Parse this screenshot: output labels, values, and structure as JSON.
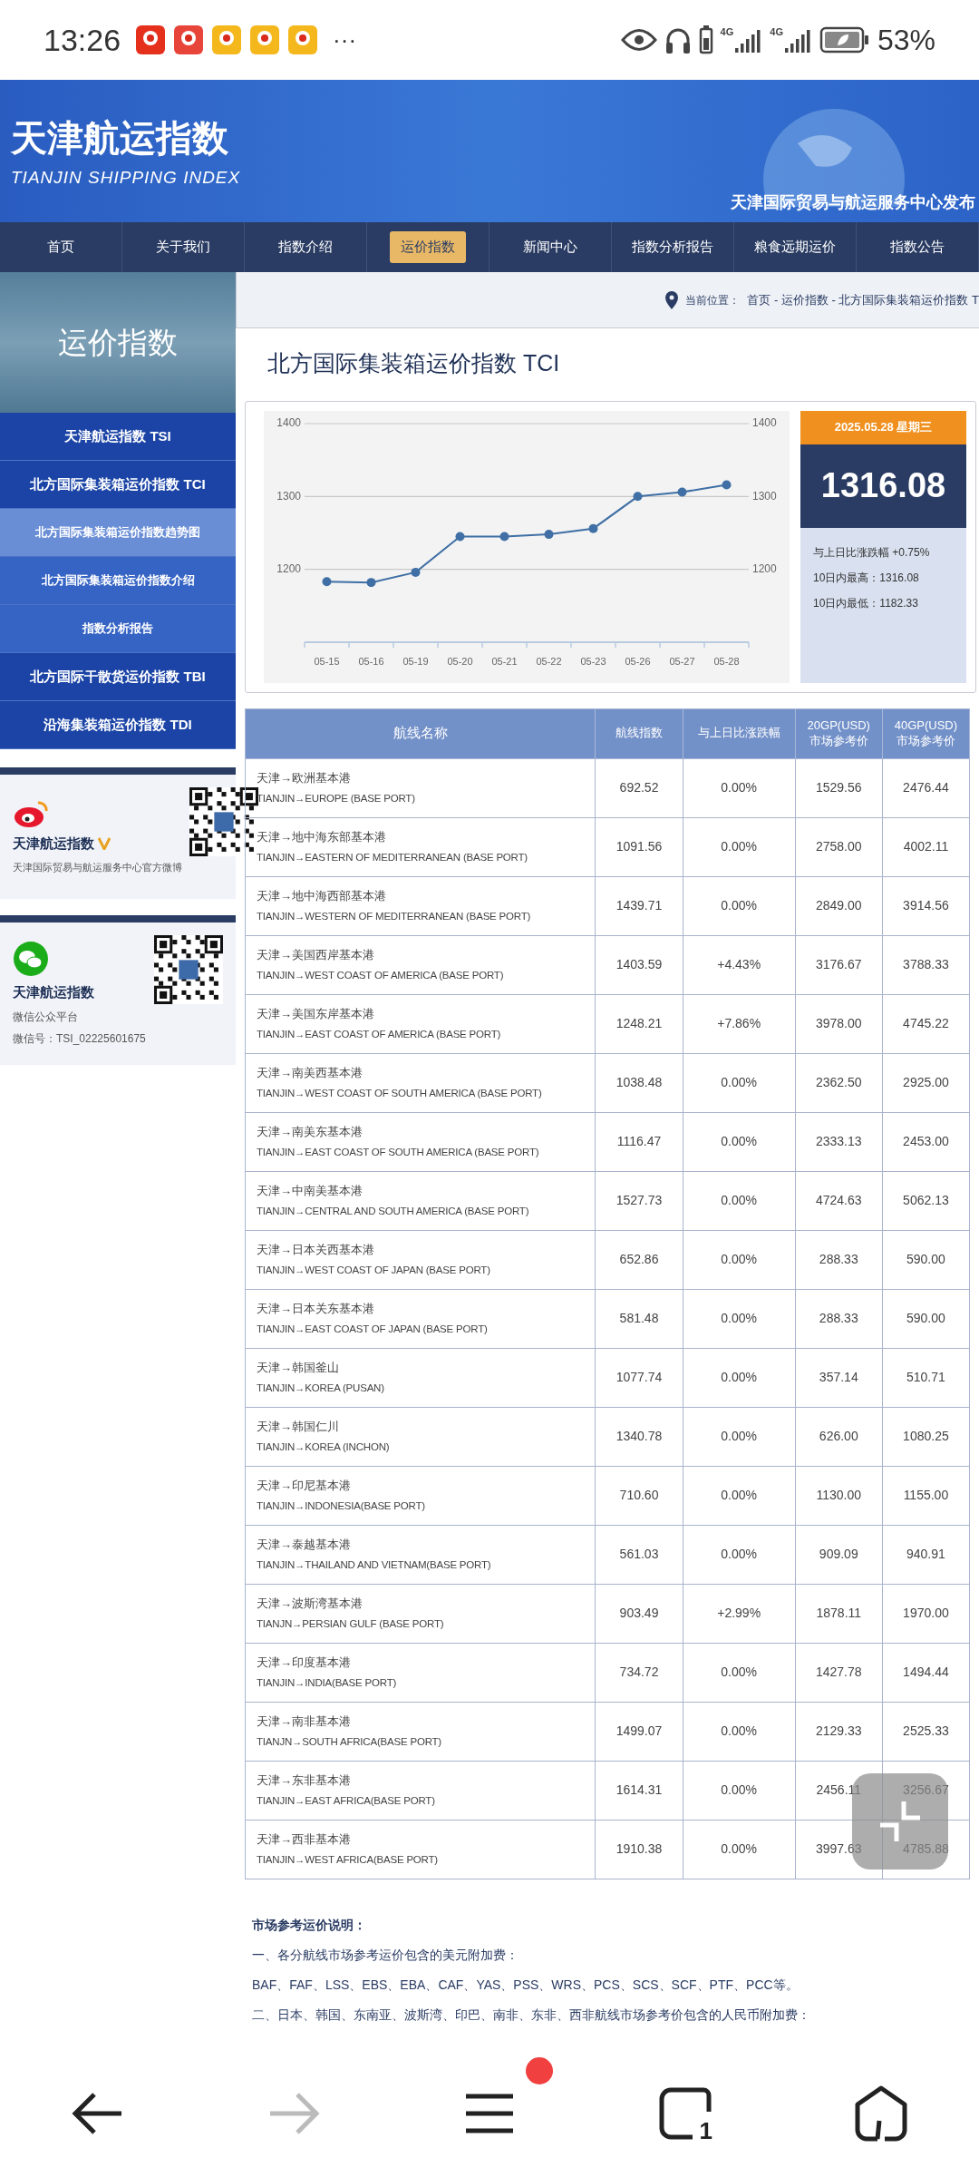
{
  "status_bar": {
    "time": "13:26",
    "more": "···",
    "network": [
      "4G",
      "4G"
    ],
    "battery": "53%"
  },
  "header": {
    "title_cn": "天津航运指数",
    "title_en": "TIANJIN SHIPPING INDEX",
    "slogan": "天津国际贸易与航运服务中心发布"
  },
  "nav": [
    {
      "label": "首页",
      "selected": false
    },
    {
      "label": "关于我们",
      "selected": false
    },
    {
      "label": "指数介绍",
      "selected": false
    },
    {
      "label": "运价指数",
      "selected": true
    },
    {
      "label": "新闻中心",
      "selected": false
    },
    {
      "label": "指数分析报告",
      "selected": false
    },
    {
      "label": "粮食远期运价",
      "selected": false
    },
    {
      "label": "指数公告",
      "selected": false
    }
  ],
  "sidebar": {
    "title": "运价指数",
    "items": [
      {
        "label": "天津航运指数 TSI",
        "kind": "main",
        "selected": false
      },
      {
        "label": "北方国际集装箱运价指数 TCI",
        "kind": "main",
        "selected": false
      },
      {
        "label": "北方国际集装箱运价指数趋势图",
        "kind": "sub",
        "selected": true
      },
      {
        "label": "北方国际集装箱运价指数介绍",
        "kind": "sub",
        "selected": false
      },
      {
        "label": "指数分析报告",
        "kind": "sub",
        "selected": false
      },
      {
        "label": "北方国际干散货运价指数 TBI",
        "kind": "main",
        "selected": false
      },
      {
        "label": "沿海集装箱运价指数 TDI",
        "kind": "main",
        "selected": false
      }
    ],
    "weibo": {
      "name": "天津航运指数",
      "verified": true,
      "desc": "天津国际贸易与航运服务中心官方微博"
    },
    "wechat": {
      "name": "天津航运指数",
      "line1": "微信公众平台",
      "line2": "微信号：TSI_02225601675"
    }
  },
  "breadcrumb": {
    "label": "当前位置：",
    "path": "首页 - 运价指数 - 北方国际集装箱运价指数 T"
  },
  "page_title": "北方国际集装箱运价指数 TCI",
  "chart_data": {
    "type": "line",
    "categories": [
      "05-15",
      "05-16",
      "05-19",
      "05-20",
      "05-21",
      "05-22",
      "05-23",
      "05-26",
      "05-27",
      "05-28"
    ],
    "series": [
      {
        "color": "#3f6fa5",
        "marker": "circle",
        "values": [
          1183,
          1182,
          1196,
          1245,
          1245,
          1248,
          1256,
          1300,
          1306,
          1316
        ]
      }
    ],
    "ylim": [
      1100,
      1400
    ],
    "yticks": [
      1200,
      1300,
      1400
    ],
    "annotations": [
      "1200",
      "1300",
      "1400"
    ]
  },
  "summary": {
    "date": "2025.05.28 星期三",
    "value": "1316.08",
    "change": "与上日比涨跌幅 +0.75%",
    "high": "10日内最高：1316.08",
    "low": "10日内最低：1182.33"
  },
  "table": {
    "columns": [
      {
        "label": "航线名称"
      },
      {
        "label": "航线指数"
      },
      {
        "label": "与上日比涨跌幅"
      },
      {
        "label": "20GP(USD)",
        "sublabel": "市场参考价"
      },
      {
        "label": "40GP(USD)",
        "sublabel": "市场参考价"
      }
    ],
    "rows": [
      {
        "route_cn": "天津→欧洲基本港",
        "route_en": "TIANJIN→EUROPE (BASE PORT)",
        "index": "692.52",
        "change": "0.00%",
        "gp20": "1529.56",
        "gp40": "2476.44"
      },
      {
        "route_cn": "天津→地中海东部基本港",
        "route_en": "TIANJIN→EASTERN OF MEDITERRANEAN (BASE PORT)",
        "index": "1091.56",
        "change": "0.00%",
        "gp20": "2758.00",
        "gp40": "4002.11"
      },
      {
        "route_cn": "天津→地中海西部基本港",
        "route_en": "TIANJIN→WESTERN OF MEDITERRANEAN (BASE PORT)",
        "index": "1439.71",
        "change": "0.00%",
        "gp20": "2849.00",
        "gp40": "3914.56"
      },
      {
        "route_cn": "天津→美国西岸基本港",
        "route_en": "TIANJIN→WEST COAST OF AMERICA (BASE PORT)",
        "index": "1403.59",
        "change": "+4.43%",
        "gp20": "3176.67",
        "gp40": "3788.33"
      },
      {
        "route_cn": "天津→美国东岸基本港",
        "route_en": "TIANJIN→EAST COAST OF AMERICA (BASE PORT)",
        "index": "1248.21",
        "change": "+7.86%",
        "gp20": "3978.00",
        "gp40": "4745.22"
      },
      {
        "route_cn": "天津→南美西基本港",
        "route_en": "TIANJIN→WEST COAST OF SOUTH AMERICA (BASE PORT)",
        "index": "1038.48",
        "change": "0.00%",
        "gp20": "2362.50",
        "gp40": "2925.00"
      },
      {
        "route_cn": "天津→南美东基本港",
        "route_en": "TIANJIN→EAST COAST OF SOUTH AMERICA (BASE PORT)",
        "index": "1116.47",
        "change": "0.00%",
        "gp20": "2333.13",
        "gp40": "2453.00"
      },
      {
        "route_cn": "天津→中南美基本港",
        "route_en": "TIANJIN→CENTRAL AND SOUTH AMERICA (BASE PORT)",
        "index": "1527.73",
        "change": "0.00%",
        "gp20": "4724.63",
        "gp40": "5062.13"
      },
      {
        "route_cn": "天津→日本关西基本港",
        "route_en": "TIANJIN→WEST COAST OF JAPAN (BASE PORT)",
        "index": "652.86",
        "change": "0.00%",
        "gp20": "288.33",
        "gp40": "590.00"
      },
      {
        "route_cn": "天津→日本关东基本港",
        "route_en": "TIANJIN→EAST COAST OF JAPAN (BASE PORT)",
        "index": "581.48",
        "change": "0.00%",
        "gp20": "288.33",
        "gp40": "590.00"
      },
      {
        "route_cn": "天津→韩国釜山",
        "route_en": "TIANJIN→KOREA (PUSAN)",
        "index": "1077.74",
        "change": "0.00%",
        "gp20": "357.14",
        "gp40": "510.71"
      },
      {
        "route_cn": "天津→韩国仁川",
        "route_en": "TIANJIN→KOREA (INCHON)",
        "index": "1340.78",
        "change": "0.00%",
        "gp20": "626.00",
        "gp40": "1080.25"
      },
      {
        "route_cn": "天津→印尼基本港",
        "route_en": "TIANJIN→INDONESIA(BASE PORT)",
        "index": "710.60",
        "change": "0.00%",
        "gp20": "1130.00",
        "gp40": "1155.00"
      },
      {
        "route_cn": "天津→泰越基本港",
        "route_en": "TIANJIN→THAILAND AND VIETNAM(BASE PORT)",
        "index": "561.03",
        "change": "0.00%",
        "gp20": "909.09",
        "gp40": "940.91"
      },
      {
        "route_cn": "天津→波斯湾基本港",
        "route_en": "TIANJN→PERSIAN GULF (BASE PORT)",
        "index": "903.49",
        "change": "+2.99%",
        "gp20": "1878.11",
        "gp40": "1970.00"
      },
      {
        "route_cn": "天津→印度基本港",
        "route_en": "TIANJIN→INDIA(BASE PORT)",
        "index": "734.72",
        "change": "0.00%",
        "gp20": "1427.78",
        "gp40": "1494.44"
      },
      {
        "route_cn": "天津→南非基本港",
        "route_en": "TIANJN→SOUTH AFRICA(BASE PORT)",
        "index": "1499.07",
        "change": "0.00%",
        "gp20": "2129.33",
        "gp40": "2525.33"
      },
      {
        "route_cn": "天津→东非基本港",
        "route_en": "TIANJIN→EAST AFRICA(BASE PORT)",
        "index": "1614.31",
        "change": "0.00%",
        "gp20": "2456.11",
        "gp40": "3256.67"
      },
      {
        "route_cn": "天津→西非基本港",
        "route_en": "TIANJIN→WEST AFRICA(BASE PORT)",
        "index": "1910.38",
        "change": "0.00%",
        "gp20": "3997.63",
        "gp40": "4785.88"
      }
    ]
  },
  "notes": {
    "title": "市场参考运价说明：",
    "lines": [
      "一、各分航线市场参考运价包含的美元附加费：",
      "BAF、FAF、LSS、EBS、EBA、CAF、YAS、PSS、WRS、PCS、SCS、SCF、PTF、PCC等。",
      "二、日本、韩国、东南亚、波斯湾、印巴、南非、东非、西非航线市场参考价包含的人民币附加费："
    ]
  },
  "bottom_nav": {
    "menu_badge": true,
    "tab_count": "1"
  }
}
